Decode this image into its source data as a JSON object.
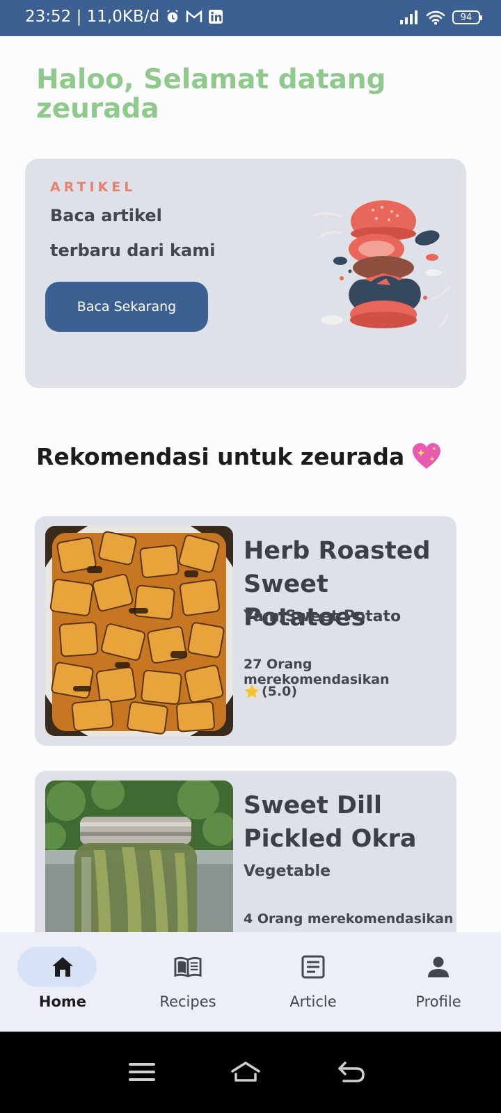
{
  "status_bar": {
    "time_info": "23:52 | 11,0KB/d",
    "battery": "94",
    "left_icons": [
      "alarm-icon",
      "gmail-icon",
      "linkedin-icon"
    ],
    "right_icons": [
      "signal-icon",
      "wifi-icon",
      "battery-icon"
    ]
  },
  "greeting": "Haloo, Selamat datang zeurada",
  "article_card": {
    "eyebrow": "ARTIKEL",
    "line1": "Baca artikel",
    "line2": "terbaru dari kami",
    "button_label": "Baca Sekarang",
    "illustration": "burger-illustration"
  },
  "recommendation": {
    "title": "Rekomendasi untuk zeurada",
    "emoji": "sparkling-heart-icon"
  },
  "recipes": [
    {
      "title": "Herb Roasted Sweet Potatoes",
      "category": "Yam/Sweet Potato",
      "recommend_text": "27 Orang merekomendasikan",
      "rating": "(5.0)"
    },
    {
      "title": "Sweet Dill Pickled Okra",
      "category": "Vegetable",
      "recommend_text": "4 Orang merekomendasikan",
      "rating": ""
    }
  ],
  "bottom_nav": [
    {
      "label": "Home",
      "icon": "home-icon",
      "active": true
    },
    {
      "label": "Recipes",
      "icon": "book-icon",
      "active": false
    },
    {
      "label": "Article",
      "icon": "article-icon",
      "active": false
    },
    {
      "label": "Profile",
      "icon": "person-icon",
      "active": false
    }
  ],
  "colors": {
    "primary": "#3d6093",
    "greeting": "#8fc98c",
    "eyebrow": "#e6806f",
    "card": "#dfe1e9",
    "nav_bg": "#eceff7",
    "nav_active_pill": "#d7e2f7"
  }
}
